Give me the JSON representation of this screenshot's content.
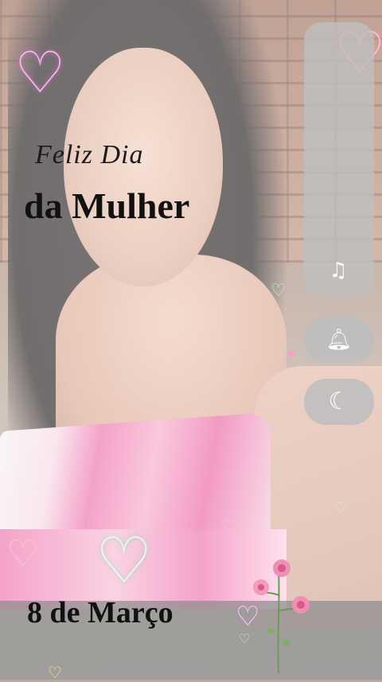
{
  "greeting": {
    "line1": "Feliz Dia",
    "line2": "da Mulher",
    "date": "8 de Março"
  },
  "controls": {
    "volume_slider_level": 0,
    "icons": [
      "music-muted-icon",
      "bell-icon",
      "moon-icon"
    ]
  },
  "colors": {
    "panel": "#bebebe",
    "text": "#111111",
    "heart_pink": "#f3b6e8",
    "heart_mint": "#b8efd8"
  }
}
